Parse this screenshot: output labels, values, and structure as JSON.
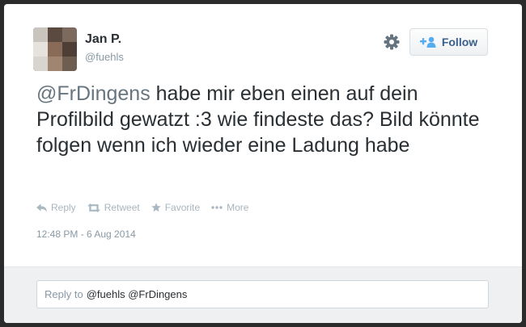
{
  "user": {
    "name": "Jan P.",
    "handle": "@fuehls"
  },
  "follow_button": {
    "label": "Follow"
  },
  "tweet": {
    "mention": "@FrDingens",
    "body": " habe mir eben einen auf dein Profilbild gewatzt :3 wie findeste das? Bild könnte folgen wenn ich wieder eine Ladung habe",
    "timestamp": "12:48 PM - 6 Aug 2014"
  },
  "actions": [
    {
      "label": "Reply",
      "icon": "reply-icon"
    },
    {
      "label": "Retweet",
      "icon": "retweet-icon"
    },
    {
      "label": "Favorite",
      "icon": "star-icon"
    },
    {
      "label": "More",
      "icon": "more-dots-icon"
    }
  ],
  "reply_box": {
    "prefix": "Reply to",
    "recipients": "@fuehls @FrDingens"
  },
  "colors": {
    "background": "#2b2b2b",
    "card": "#ffffff",
    "text": "#292f33",
    "muted": "#8899a6",
    "follow_text": "#3a5f8a"
  }
}
